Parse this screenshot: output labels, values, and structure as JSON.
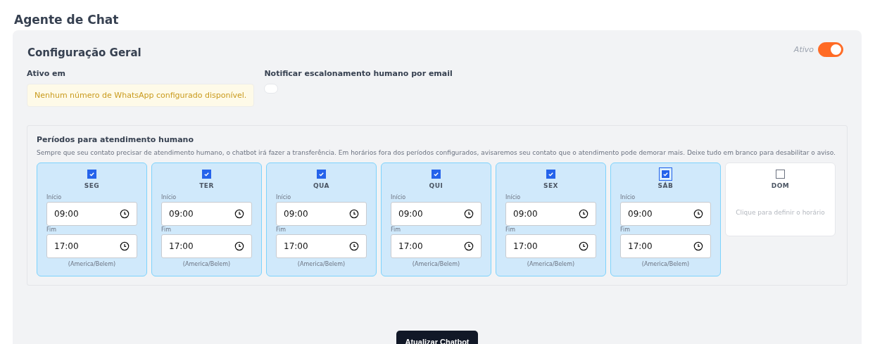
{
  "page_title": "Agente de Chat",
  "config": {
    "title": "Configuração Geral",
    "status_label": "Ativo",
    "active": true,
    "active_in": {
      "label": "Ativo em",
      "notice": "Nenhum número de WhatsApp configurado disponível."
    },
    "notify": {
      "label": "Notificar escalonamento humano por email",
      "on": false
    }
  },
  "periods": {
    "title": "Períodos para atendimento humano",
    "description": "Sempre que seu contato precisar de atendimento humano, o chatbot irá fazer a transferência. Em horários fora dos períodos configurados, avisaremos seu contato que o atendimento pode demorar mais. Deixe tudo em branco para desabilitar o aviso.",
    "days": [
      {
        "day": "SEG",
        "checked": true,
        "focused": false,
        "start_label": "Início",
        "start": "09:00",
        "end_label": "Fim",
        "end": "17:00",
        "timezone": "(America/Belem)"
      },
      {
        "day": "TER",
        "checked": true,
        "focused": false,
        "start_label": "Início",
        "start": "09:00",
        "end_label": "Fim",
        "end": "17:00",
        "timezone": "(America/Belem)"
      },
      {
        "day": "QUA",
        "checked": true,
        "focused": false,
        "start_label": "Início",
        "start": "09:00",
        "end_label": "Fim",
        "end": "17:00",
        "timezone": "(America/Belem)"
      },
      {
        "day": "QUI",
        "checked": true,
        "focused": false,
        "start_label": "Início",
        "start": "09:00",
        "end_label": "Fim",
        "end": "17:00",
        "timezone": "(America/Belem)"
      },
      {
        "day": "SEX",
        "checked": true,
        "focused": false,
        "start_label": "Início",
        "start": "09:00",
        "end_label": "Fim",
        "end": "17:00",
        "timezone": "(America/Belem)"
      },
      {
        "day": "SÁB",
        "checked": true,
        "focused": true,
        "start_label": "Início",
        "start": "09:00",
        "end_label": "Fim",
        "end": "17:00",
        "timezone": "(America/Belem)"
      },
      {
        "day": "DOM",
        "checked": false,
        "focused": false,
        "hint": "Clique para definir o horário"
      }
    ]
  },
  "submit_button": "Atualizar Chatbot"
}
